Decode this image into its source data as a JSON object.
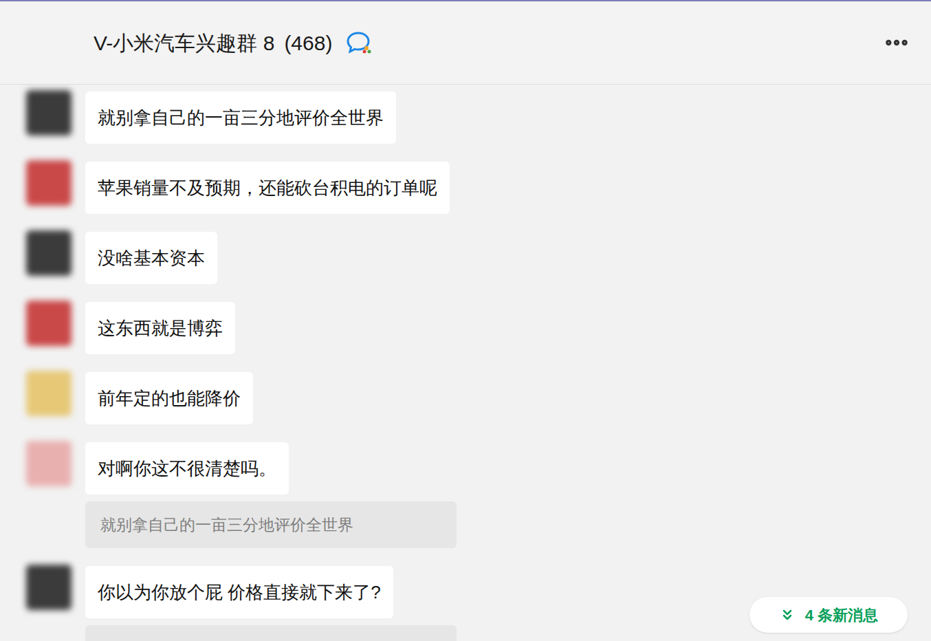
{
  "window": {
    "title": "V-小米汽车兴趣群 8",
    "member_count": "(468)"
  },
  "messages": [
    {
      "text": "就别拿自己的一亩三分地评价全世界",
      "color": "#3b3b3b"
    },
    {
      "text": "苹果销量不及预期，还能砍台积电的订单呢",
      "color": "#c94848"
    },
    {
      "text": "没啥基本资本",
      "color": "#3b3b3b"
    },
    {
      "text": "这东西就是博弈",
      "color": "#c94848"
    },
    {
      "text": "前年定的也能降价",
      "color": "#e6c877"
    },
    {
      "text": "对啊你这不很清楚吗。",
      "color": "#e9b0b0",
      "quote": "就别拿自己的一亩三分地评价全世界"
    },
    {
      "text": "你以为你放个屁 价格直接就下来了?",
      "color": "#3b3b3b",
      "quote": ""
    }
  ],
  "new_messages": {
    "label": "4 条新消息"
  }
}
